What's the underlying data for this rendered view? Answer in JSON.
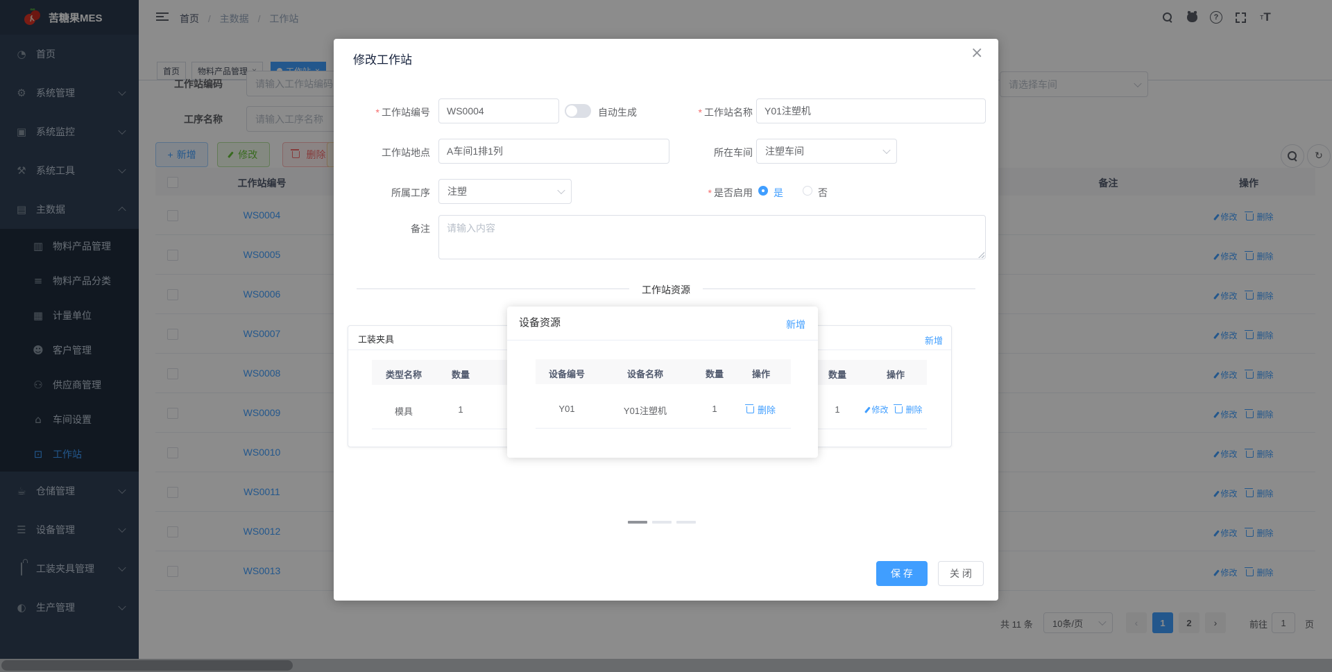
{
  "app": {
    "logo_title": "苦糖果MES"
  },
  "icons": {
    "close": "×",
    "plus": "+",
    "refresh": "↻",
    "slash": "/",
    "help": "?",
    "font_small": "т",
    "font_big": "T",
    "dashboard": "◔",
    "gear": "⚙",
    "monitor": "▣",
    "tools": "⚒",
    "database": "▤",
    "product": "▥",
    "category": "≡",
    "unit": "▦",
    "customer": "☻",
    "supplier": "⚇",
    "workshop": "⌂",
    "workstation": "⊡",
    "warehouse": "☕",
    "equipment": "☰",
    "production": "◐",
    "prev_arrow": "‹",
    "next_arrow": "›"
  },
  "colors": {
    "primary": "#409eff",
    "success": "#67c23a",
    "danger": "#f56c6c",
    "warning": "#e6a23c",
    "sidebar_bg": "#304156",
    "submenu_bg": "#1f2d3d"
  },
  "sidebar": {
    "top_items": [
      {
        "label": "首页"
      },
      {
        "label": "系统管理"
      },
      {
        "label": "系统监控"
      },
      {
        "label": "系统工具"
      },
      {
        "label": "主数据"
      }
    ],
    "sub_items": [
      {
        "label": "物料产品管理"
      },
      {
        "label": "物料产品分类"
      },
      {
        "label": "计量单位"
      },
      {
        "label": "客户管理"
      },
      {
        "label": "供应商管理"
      },
      {
        "label": "车间设置"
      },
      {
        "label": "工作站"
      }
    ],
    "bottom_items": [
      {
        "label": "仓储管理"
      },
      {
        "label": "设备管理"
      },
      {
        "label": "工装夹具管理"
      },
      {
        "label": "生产管理"
      }
    ]
  },
  "navbar": {
    "breadcrumb": [
      "首页",
      "主数据",
      "工作站"
    ]
  },
  "tabs": {
    "items": [
      {
        "label": "首页"
      },
      {
        "label": "物料产品管理"
      },
      {
        "label": "工作站"
      }
    ]
  },
  "filters": {
    "station_code_label": "工作站编码",
    "station_code_placeholder": "请输入工作站编码",
    "process_name_label": "工序名称",
    "process_name_placeholder": "请输入工序名称",
    "workshop_placeholder": "请选择车间"
  },
  "toolbar": {
    "add": "新增",
    "edit": "修改",
    "delete": "删除"
  },
  "table": {
    "headers": {
      "code": "工作站编号",
      "remark": "备注",
      "action": "操作"
    },
    "rows": [
      "WS0004",
      "WS0005",
      "WS0006",
      "WS0007",
      "WS0008",
      "WS0009",
      "WS0010",
      "WS0011",
      "WS0012",
      "WS0013"
    ],
    "actions": {
      "edit": "修改",
      "delete": "删除"
    }
  },
  "pagination": {
    "total": "共 11 条",
    "page_size": "10条/页",
    "page_1": "1",
    "page_2": "2",
    "goto_label": "前往",
    "goto_value": "1",
    "page_unit": "页"
  },
  "modal": {
    "title": "修改工作站",
    "station_code_label": "工作站编号",
    "station_code_value": "WS0004",
    "auto_generate_label": "自动生成",
    "station_name_label": "工作站名称",
    "station_name_value": "Y01注塑机",
    "location_label": "工作站地点",
    "location_value": "A车间1排1列",
    "workshop_label": "所在车间",
    "workshop_value": "注塑车间",
    "process_label": "所属工序",
    "process_value": "注塑",
    "enabled_label": "是否启用",
    "enabled_yes": "是",
    "enabled_no": "否",
    "remark_label": "备注",
    "remark_placeholder": "请输入内容",
    "section_title": "工作站资源",
    "fixture_card": {
      "title": "工装夹具",
      "add": "新增",
      "col_type": "类型名称",
      "col_qty": "数量",
      "col_qty_right": "数量",
      "col_action": "操作",
      "row_type": "模具",
      "row_qty": "1",
      "row_qty_right": "1",
      "edit": "修改",
      "delete": "删除"
    },
    "device_dialog": {
      "title": "设备资源",
      "add": "新增",
      "col_code": "设备编号",
      "col_name": "设备名称",
      "col_qty": "数量",
      "col_action": "操作",
      "row_code": "Y01",
      "row_name": "Y01注塑机",
      "row_qty": "1",
      "delete": "删除"
    },
    "save": "保 存",
    "close": "关 闭"
  }
}
